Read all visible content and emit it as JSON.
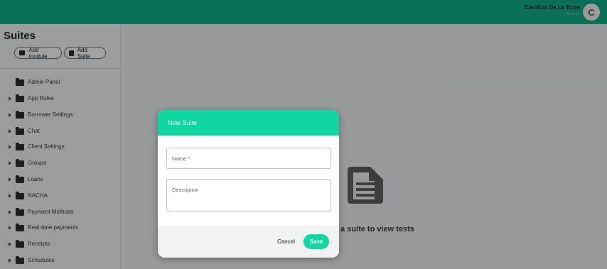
{
  "header": {
    "user_name": "Carolina De La Torre",
    "user_role": "Tester",
    "avatar_initial": "C",
    "brand_color": "#0ea880"
  },
  "sidebar": {
    "title": "Suites",
    "add_module_label": "Add module",
    "add_suite_label": "Add Suite",
    "items": [
      {
        "label": "Admin Panel",
        "expandable": false
      },
      {
        "label": "App Rules",
        "expandable": true
      },
      {
        "label": "Borrower Settings",
        "expandable": true
      },
      {
        "label": "Chat",
        "expandable": true
      },
      {
        "label": "Client Settings",
        "expandable": true
      },
      {
        "label": "Groups",
        "expandable": true
      },
      {
        "label": "Loans",
        "expandable": true
      },
      {
        "label": "NACHA",
        "expandable": true
      },
      {
        "label": "Payment Methods",
        "expandable": true
      },
      {
        "label": "Real-time payments",
        "expandable": true
      },
      {
        "label": "Receipts",
        "expandable": true
      },
      {
        "label": "Schedules",
        "expandable": true
      }
    ]
  },
  "main": {
    "empty_message": "a suite to view tests",
    "icon": "document-icon"
  },
  "modal": {
    "title": "New Suite",
    "name_placeholder": "Name *",
    "description_placeholder": "Description",
    "cancel_label": "Cancel",
    "save_label": "Save",
    "accent_color": "#0fd79f"
  }
}
